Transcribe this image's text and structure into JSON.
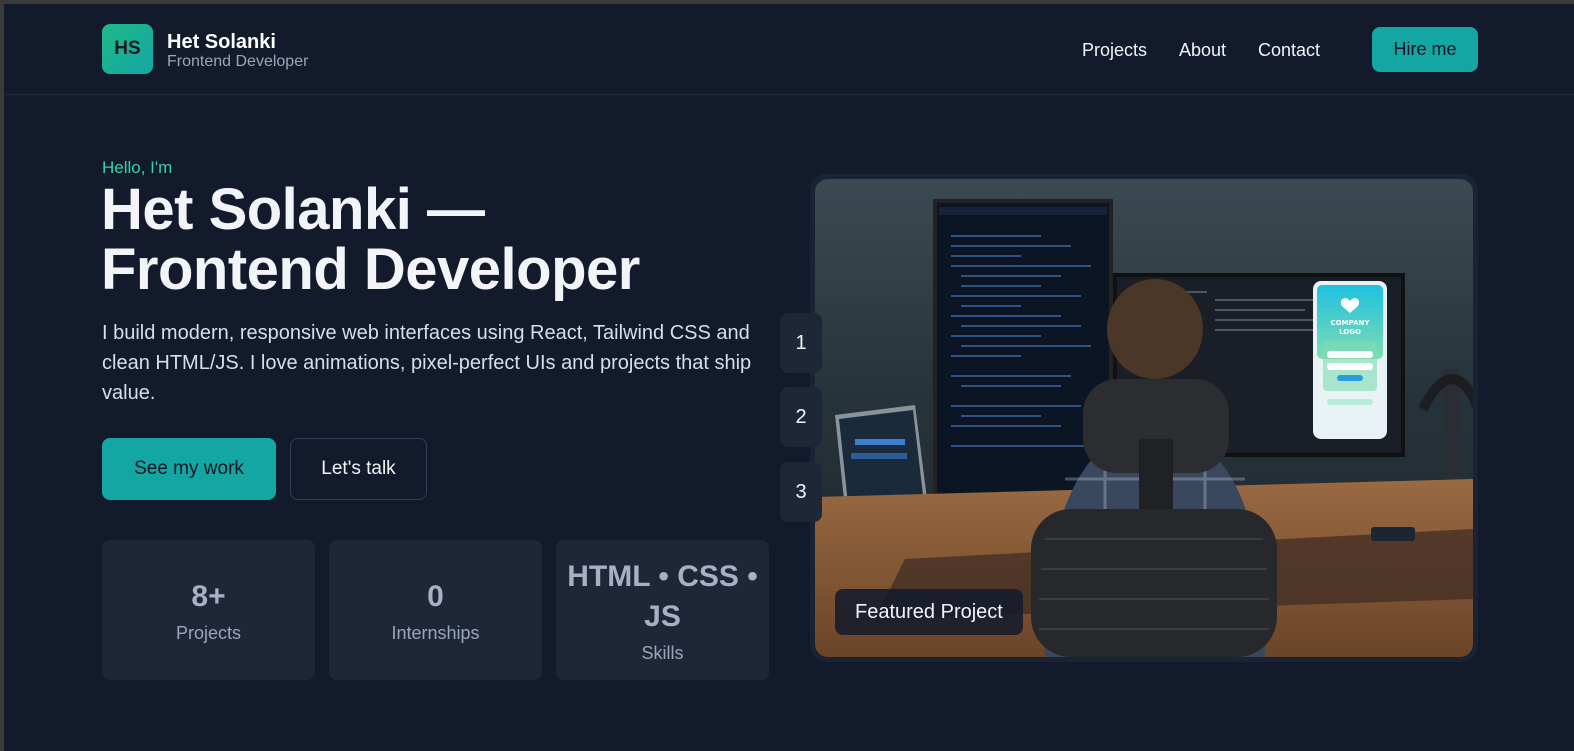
{
  "brand": {
    "initials": "HS",
    "name": "Het Solanki",
    "role": "Frontend Developer"
  },
  "nav": {
    "items": [
      "Projects",
      "About",
      "Contact"
    ],
    "cta": "Hire me"
  },
  "hero": {
    "greeting": "Hello, I'm",
    "headline_line1": "Het Solanki —",
    "headline_line2": "Frontend Developer",
    "description": "I build modern, responsive web interfaces using React, Tailwind CSS and clean HTML/JS. I love animations, pixel-perfect UIs and projects that ship value.",
    "primary_button": "See my work",
    "secondary_button": "Let's talk"
  },
  "stats": [
    {
      "value": "8+",
      "label": "Projects"
    },
    {
      "value": "0",
      "label": "Internships"
    },
    {
      "value": "HTML • CSS • JS",
      "label": "Skills"
    }
  ],
  "carousel": {
    "indicators": [
      "1",
      "2",
      "3"
    ],
    "caption": "Featured Project",
    "phone_logo_text": "COMPANY LOGO"
  },
  "colors": {
    "accent": "#13a6a3",
    "greeting": "#2fd6a3",
    "background": "#121a2b",
    "card": "#1e2738"
  }
}
